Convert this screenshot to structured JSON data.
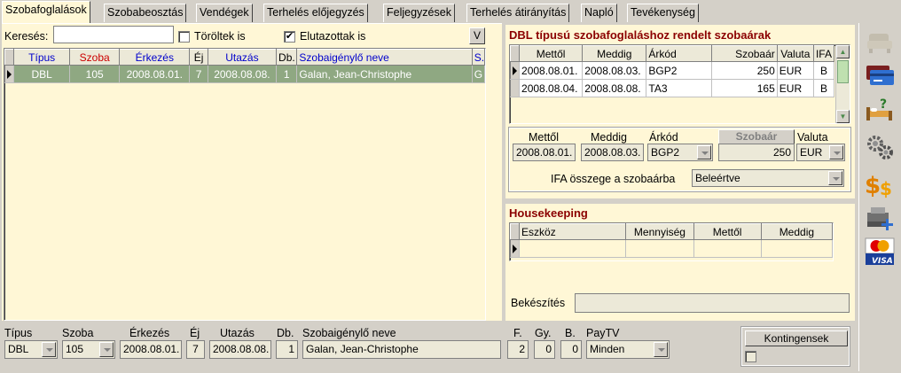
{
  "tabs": [
    {
      "label": "Szobafoglalások",
      "active": true
    },
    {
      "label": "Szobabeosztás"
    },
    {
      "label": "Vendégek"
    },
    {
      "label": "Terhelés előjegyzés"
    },
    {
      "label": "Feljegyzések"
    },
    {
      "label": "Terhelés átirányítás"
    },
    {
      "label": "Napló"
    },
    {
      "label": "Tevékenység"
    }
  ],
  "search": {
    "label": "Keresés:",
    "value": "",
    "deleted_label": "Töröltek is",
    "deleted_checked": "",
    "departed_label": "Elutazottak is",
    "departed_checked": "✔",
    "v_button": "V"
  },
  "bookings": {
    "headers": [
      "Típus",
      "Szoba",
      "Érkezés",
      "Éj",
      "Utazás",
      "Db.",
      "Szobaigénylő neve",
      "S."
    ],
    "header_colors": [
      "#0000cc",
      "#cc0000",
      "#0000cc",
      "#000000",
      "#0000cc",
      "#000000",
      "#0000cc",
      "#0000cc"
    ],
    "rows": [
      [
        "DBL",
        "105",
        "2008.08.01.",
        "7",
        "2008.08.08.",
        "1",
        "Galan, Jean-Christophe",
        "G"
      ]
    ]
  },
  "rates": {
    "title": "DBL típusú szobafoglaláshoz rendelt szobaárak",
    "headers": [
      "Mettől",
      "Meddig",
      "Árkód",
      "Szobaár",
      "Valuta",
      "IFA"
    ],
    "rows": [
      [
        "2008.08.01.",
        "2008.08.03.",
        "BGP2",
        "250",
        "EUR",
        "B"
      ],
      [
        "2008.08.04.",
        "2008.08.08.",
        "TA3",
        "165",
        "EUR",
        "B"
      ]
    ],
    "form": {
      "from_label": "Mettől",
      "from_value": "2008.08.01.",
      "to_label": "Meddig",
      "to_value": "2008.08.03.",
      "code_label": "Árkód",
      "code_value": "BGP2",
      "price_label": "Szobaár",
      "price_value": "250",
      "currency_label": "Valuta",
      "currency_value": "EUR",
      "ifa_label": "IFA összege a szobaárba",
      "ifa_value": "Beleértve"
    }
  },
  "housekeeping": {
    "title": "Housekeeping",
    "headers": [
      "Eszköz",
      "Mennyiség",
      "Mettől",
      "Meddig"
    ],
    "prep_label": "Bekészítés",
    "prep_value": ""
  },
  "bottom": {
    "type_label": "Típus",
    "type_value": "DBL",
    "room_label": "Szoba",
    "room_value": "105",
    "arrival_label": "Érkezés",
    "arrival_value": "2008.08.01.",
    "nights_label": "Éj",
    "nights_value": "7",
    "departure_label": "Utazás",
    "departure_value": "2008.08.08.",
    "count_label": "Db.",
    "count_value": "1",
    "name_label": "Szobaigénylő neve",
    "name_value": "Galan, Jean-Christophe",
    "f_label": "F.",
    "f_value": "2",
    "gy_label": "Gy.",
    "gy_value": "0",
    "b_label": "B.",
    "b_value": "0",
    "paytv_label": "PayTV",
    "paytv_value": "Minden",
    "quota_button": "Kontingensek"
  },
  "toolbar_icons": [
    "armchair-icon",
    "credit-cards-icon",
    "bed-question-icon",
    "gears-icon",
    "dollar-icon",
    "cash-register-icon",
    "mastercard-visa-icon"
  ]
}
